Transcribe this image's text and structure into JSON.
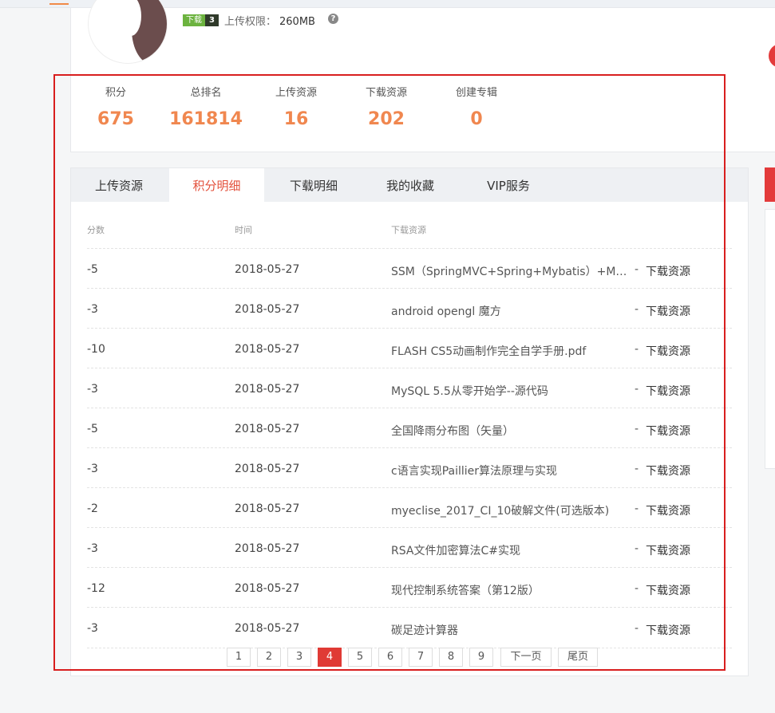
{
  "profile": {
    "badge": {
      "text": "下载",
      "level": "3"
    },
    "upload_limit_label": "上传权限：",
    "upload_limit_value": "260MB"
  },
  "stats": [
    {
      "label": "积分",
      "value": "675"
    },
    {
      "label": "总排名",
      "value": "161814"
    },
    {
      "label": "上传资源",
      "value": "16"
    },
    {
      "label": "下载资源",
      "value": "202"
    },
    {
      "label": "创建专辑",
      "value": "0"
    }
  ],
  "tabs": [
    {
      "label": "上传资源",
      "active": false
    },
    {
      "label": "积分明细",
      "active": true
    },
    {
      "label": "下载明细",
      "active": false
    },
    {
      "label": "我的收藏",
      "active": false
    },
    {
      "label": "VIP服务",
      "active": false
    }
  ],
  "table": {
    "headers": [
      "分数",
      "时间",
      "下载资源"
    ],
    "rows": [
      {
        "score": "-5",
        "date": "2018-05-27",
        "resource": "SSM（SpringMVC+Spring+Mybatis）+Ma...",
        "dash": "-",
        "action": "下载资源"
      },
      {
        "score": "-3",
        "date": "2018-05-27",
        "resource": "android opengl 魔方",
        "dash": "-",
        "action": "下载资源"
      },
      {
        "score": "-10",
        "date": "2018-05-27",
        "resource": "FLASH CS5动画制作完全自学手册.pdf",
        "dash": "-",
        "action": "下载资源"
      },
      {
        "score": "-3",
        "date": "2018-05-27",
        "resource": "MySQL 5.5从零开始学--源代码",
        "dash": "-",
        "action": "下载资源"
      },
      {
        "score": "-5",
        "date": "2018-05-27",
        "resource": "全国降雨分布图（矢量）",
        "dash": "-",
        "action": "下载资源"
      },
      {
        "score": "-3",
        "date": "2018-05-27",
        "resource": "c语言实现Paillier算法原理与实现",
        "dash": "-",
        "action": "下载资源"
      },
      {
        "score": "-2",
        "date": "2018-05-27",
        "resource": "myeclise_2017_CI_10破解文件(可选版本)",
        "dash": "-",
        "action": "下载资源"
      },
      {
        "score": "-3",
        "date": "2018-05-27",
        "resource": "RSA文件加密算法C#实现",
        "dash": "-",
        "action": "下载资源"
      },
      {
        "score": "-12",
        "date": "2018-05-27",
        "resource": "现代控制系统答案（第12版）",
        "dash": "-",
        "action": "下载资源"
      },
      {
        "score": "-3",
        "date": "2018-05-27",
        "resource": "碳足迹计算器",
        "dash": "-",
        "action": "下载资源"
      }
    ]
  },
  "pagination": {
    "pages": [
      "1",
      "2",
      "3",
      "4",
      "5",
      "6",
      "7",
      "8",
      "9"
    ],
    "current": "4",
    "next_label": "下一页",
    "last_label": "尾页"
  },
  "colors": {
    "accent_orange": "#f0874f",
    "active_tab_text": "#e3513c",
    "highlight_frame": "#d81e1e",
    "pager_active": "#e03a35",
    "badge_green": "#6cb33f"
  },
  "icons": {
    "help": "question-circle-icon",
    "avatar": "user-avatar"
  }
}
